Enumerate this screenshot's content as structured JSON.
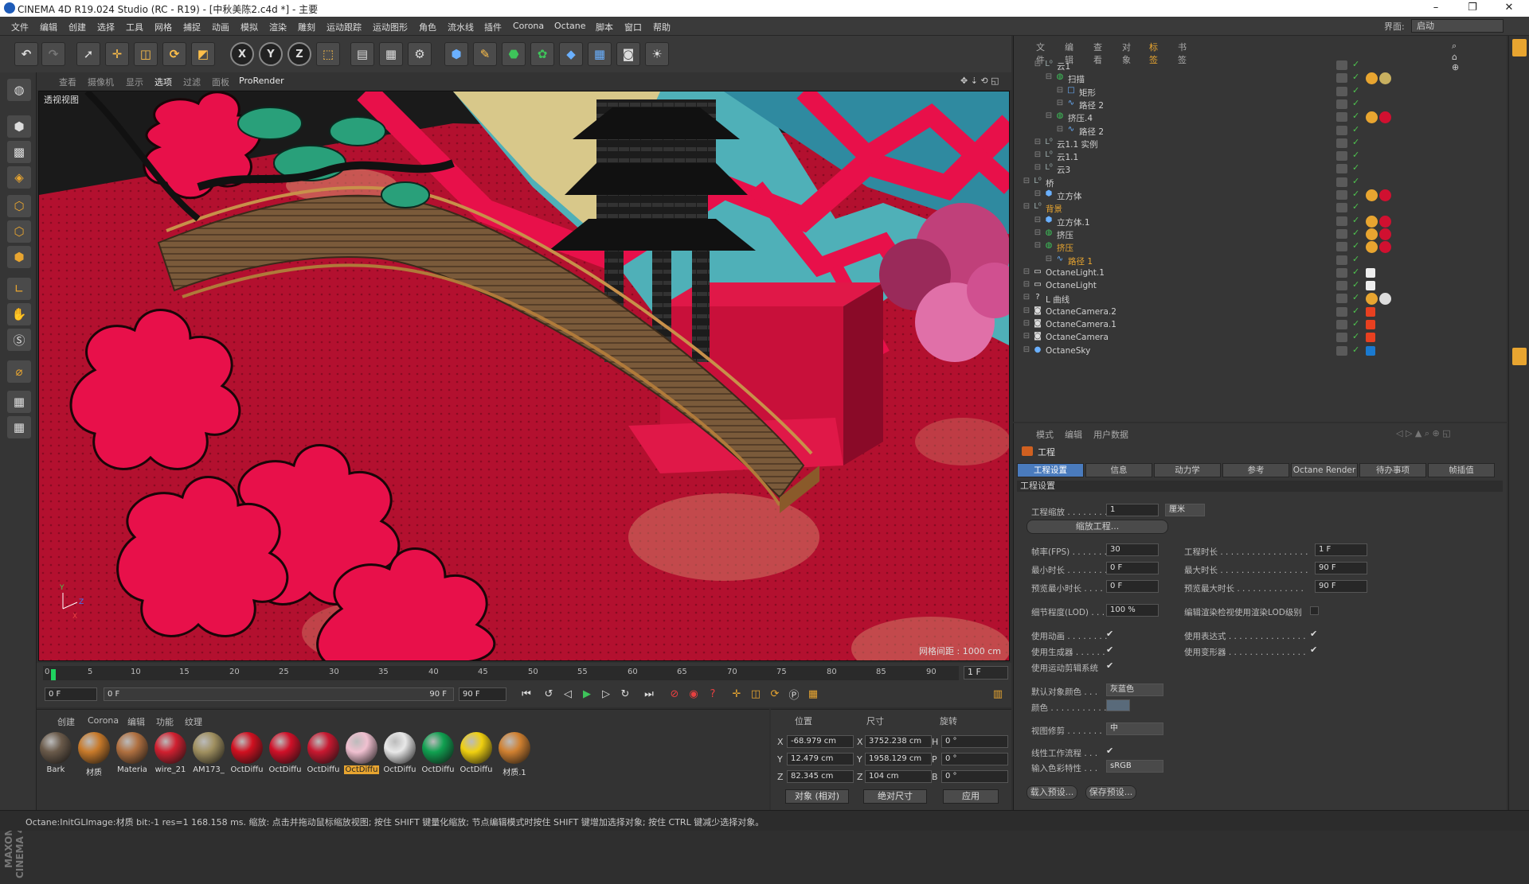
{
  "window": {
    "title": "CINEMA 4D R19.024 Studio (RC - R19) - [中秋美陈2.c4d *] - 主要",
    "minimize": "–",
    "maximize": "❐",
    "close": "✕"
  },
  "menubar": {
    "items": [
      "文件",
      "编辑",
      "创建",
      "选择",
      "工具",
      "网格",
      "捕捉",
      "动画",
      "模拟",
      "渲染",
      "雕刻",
      "运动跟踪",
      "运动图形",
      "角色",
      "流水线",
      "插件",
      "Corona",
      "Octane",
      "脚本",
      "窗口",
      "帮助"
    ],
    "layout_label": "界面:",
    "layout_value": "启动"
  },
  "toolbar": {
    "icons": [
      "undo-icon",
      "redo-icon",
      "select-icon",
      "move-icon",
      "scale-icon",
      "rotate-icon",
      "last-tool-icon",
      "x-axis-icon",
      "y-axis-icon",
      "z-axis-icon",
      "coord-icon",
      "render-view-icon",
      "render-icon",
      "render-settings-icon",
      "cube-icon",
      "pen-icon",
      "subdivision-icon",
      "cloner-icon",
      "deformer-icon",
      "floor-icon",
      "camera-icon",
      "light-icon"
    ],
    "axis": [
      "X",
      "Y",
      "Z"
    ]
  },
  "viewport": {
    "menu": [
      "查看",
      "摄像机",
      "显示",
      "选项",
      "过滤",
      "面板",
      "ProRender"
    ],
    "title": "透视视图",
    "grid_info": "网格间距 : 1000 cm"
  },
  "timeline": {
    "ticks": [
      "0",
      "5",
      "10",
      "15",
      "20",
      "25",
      "30",
      "35",
      "40",
      "45",
      "50",
      "55",
      "60",
      "65",
      "70",
      "75",
      "80",
      "85",
      "90"
    ],
    "current_frame": "1 F",
    "start": "0 F",
    "range_start": "0 F",
    "range_end": "90 F",
    "end": "90 F"
  },
  "materials": {
    "menu": [
      "创建",
      "Corona",
      "编辑",
      "功能",
      "纹理"
    ],
    "items": [
      {
        "label": "Bark",
        "color": "#6a5a4a"
      },
      {
        "label": "材质",
        "color": "#c87a2a"
      },
      {
        "label": "Materia",
        "color": "#b07040"
      },
      {
        "label": "wire_21",
        "color": "#d02030"
      },
      {
        "label": "AM173_",
        "color": "#a09060"
      },
      {
        "label": "OctDiffu",
        "color": "#d01020"
      },
      {
        "label": "OctDiffu",
        "color": "#d01028"
      },
      {
        "label": "OctDiffu",
        "color": "#c81830"
      },
      {
        "label": "OctDiffu",
        "color": "#f0c0d0"
      },
      {
        "label": "OctDiffu",
        "color": "#e8e8e8"
      },
      {
        "label": "OctDiffu",
        "color": "#10a050"
      },
      {
        "label": "OctDiffu",
        "color": "#f0d010"
      },
      {
        "label": "材质.1",
        "color": "#d08030"
      }
    ]
  },
  "coords": {
    "headers": [
      "位置",
      "尺寸",
      "旋转"
    ],
    "x_pos": "-68.979 cm",
    "y_pos": "12.479 cm",
    "z_pos": "82.345 cm",
    "x_size": "3752.238 cm",
    "y_size": "1958.129 cm",
    "z_size": "104 cm",
    "h_rot": "0 °",
    "p_rot": "0 °",
    "b_rot": "0 °",
    "axis_labels": [
      "X",
      "Y",
      "Z",
      "X",
      "Y",
      "Z",
      "H",
      "P",
      "B"
    ],
    "mode_object": "对象 (相对)",
    "mode_size": "绝对尺寸",
    "apply": "应用"
  },
  "status": {
    "text": "Octane:InitGLImage:材质 bit:-1 res=1 168.158 ms.    缩放: 点击并拖动鼠标缩放视图; 按住 SHIFT 键量化缩放; 节点编辑模式时按住 SHIFT 键增加选择对象; 按住 CTRL 键减少选择对象。"
  },
  "objects": {
    "menu": [
      "文件",
      "编辑",
      "查看",
      "对象",
      "标签",
      "书签"
    ],
    "rows": [
      {
        "name": "云1",
        "indent": 1,
        "type": "null"
      },
      {
        "name": "扫描",
        "indent": 2,
        "type": "sweep"
      },
      {
        "name": "矩形",
        "indent": 3,
        "type": "spline"
      },
      {
        "name": "路径 2",
        "indent": 3,
        "type": "path"
      },
      {
        "name": "挤压.4",
        "indent": 2,
        "type": "extrude"
      },
      {
        "name": "路径 2",
        "indent": 3,
        "type": "path"
      },
      {
        "name": "云1.1 实例",
        "indent": 1,
        "type": "null"
      },
      {
        "name": "云1.1",
        "indent": 1,
        "type": "null"
      },
      {
        "name": "云3",
        "indent": 1,
        "type": "null"
      },
      {
        "name": "桥",
        "indent": 0,
        "type": "null"
      },
      {
        "name": "立方体",
        "indent": 1,
        "type": "cube"
      },
      {
        "name": "背景",
        "indent": 0,
        "type": "null",
        "hl": true
      },
      {
        "name": "立方体.1",
        "indent": 1,
        "type": "cube"
      },
      {
        "name": "挤压",
        "indent": 1,
        "type": "extrude"
      },
      {
        "name": "挤压",
        "indent": 1,
        "type": "extrude",
        "hl": true
      },
      {
        "name": "路径 1",
        "indent": 2,
        "type": "path",
        "hl": true
      },
      {
        "name": "OctaneLight.1",
        "indent": 0,
        "type": "light"
      },
      {
        "name": "OctaneLight",
        "indent": 0,
        "type": "light"
      },
      {
        "name": "L 曲线",
        "indent": 0,
        "type": "unknown"
      },
      {
        "name": "OctaneCamera.2",
        "indent": 0,
        "type": "camera"
      },
      {
        "name": "OctaneCamera.1",
        "indent": 0,
        "type": "camera"
      },
      {
        "name": "OctaneCamera",
        "indent": 0,
        "type": "camera"
      },
      {
        "name": "OctaneSky",
        "indent": 0,
        "type": "sky"
      }
    ]
  },
  "attributes": {
    "menu": [
      "模式",
      "编辑",
      "用户数据"
    ],
    "title": "工程",
    "tabs": [
      "工程设置",
      "信息",
      "动力学",
      "参考",
      "Octane Render",
      "待办事项",
      "帧插值"
    ],
    "section": "工程设置",
    "scale_label": "工程缩放 . . . . . . . .",
    "scale_value": "1",
    "scale_unit": "厘米",
    "scale_btn": "缩放工程...",
    "fps_label": "帧率(FPS) . . . . . . .",
    "fps_value": "30",
    "time_label": "工程时长 . . . . . . . . . . . . . . . . .",
    "time_value": "1 F",
    "min_label": "最小时长 . . . . . . . .",
    "min_value": "0 F",
    "max_label": "最大时长 . . . . . . . . . . . . . . . . .",
    "max_value": "90 F",
    "pmin_label": "预览最小时长 . . . .",
    "pmin_value": "0 F",
    "pmax_label": "预览最大时长 . . . . . . . . . . . . .",
    "pmax_value": "90 F",
    "lod_label": "细节程度(LOD) . . .",
    "lod_value": "100 %",
    "lod_render_label": "编辑渲染检视使用渲染LOD级别",
    "anim_label": "使用动画 . . . . . . . .",
    "expr_label": "使用表达式 . . . . . . . . . . . . . . .",
    "gen_label": "使用生成器 . . . . . .",
    "deform_label": "使用变形器 . . . . . . . . . . . . . . .",
    "motion_label": "使用运动剪辑系统",
    "defcolor_label": "默认对象颜色 . . .",
    "defcolor_value": "灰蓝色",
    "color_label": "颜色 . . . . . . . . . . . .",
    "clip_label": "视图修剪 . . . . . . .",
    "clip_value": "中",
    "linear_label": "线性工作流程 . . .",
    "profile_label": "输入色彩特性 . . .",
    "profile_value": "sRGB",
    "load_btn": "载入预设...",
    "save_btn": "保存预设..."
  },
  "colors": {
    "accent": "#e8a530",
    "tab_active": "#4a7bbd",
    "floor": "#b0102e",
    "hotpink": "#e8104a"
  }
}
